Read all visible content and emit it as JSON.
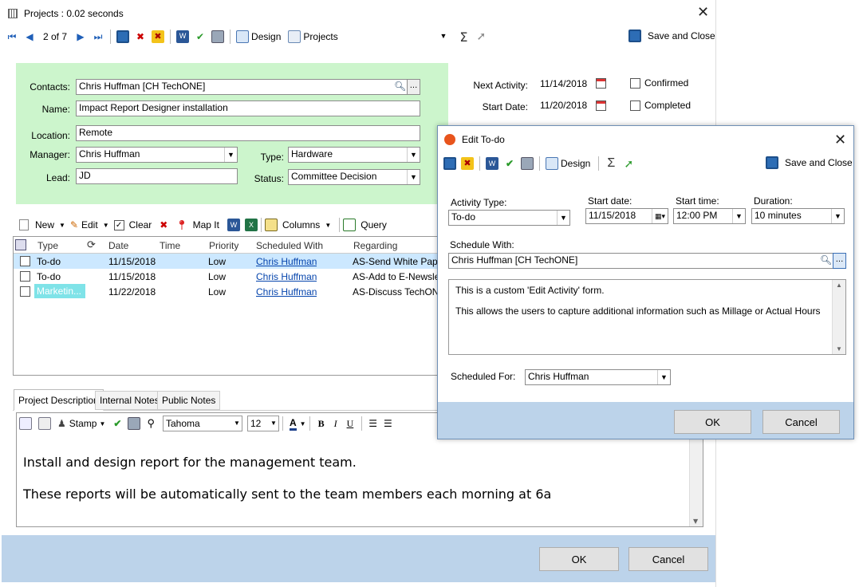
{
  "main": {
    "title": "Projects : 0.02 seconds",
    "nav": {
      "position": "2 of 7"
    },
    "toolbar": {
      "design": "Design",
      "view": "Projects",
      "save_close": "Save and Close"
    },
    "form": {
      "contacts_label": "Contacts:",
      "contacts_value": "Chris Huffman [CH TechONE]",
      "name_label": "Name:",
      "name_value": "Impact Report Designer installation",
      "location_label": "Location:",
      "location_value": "Remote",
      "manager_label": "Manager:",
      "manager_value": "Chris Huffman",
      "type_label": "Type:",
      "type_value": "Hardware",
      "lead_label": "Lead:",
      "lead_value": "JD",
      "status_label": "Status:",
      "status_value": "Committee Decision",
      "next_activity_label": "Next Activity:",
      "next_activity_value": "11/14/2018",
      "start_date_label": "Start Date:",
      "start_date_value": "11/20/2018",
      "confirmed_label": "Confirmed",
      "completed_label": "Completed"
    },
    "grid_toolbar": {
      "new": "New",
      "edit": "Edit",
      "clear": "Clear",
      "map": "Map It",
      "columns": "Columns",
      "query": "Query"
    },
    "grid": {
      "columns": [
        "Type",
        "Date",
        "Time",
        "Priority",
        "Scheduled With",
        "Regarding"
      ],
      "rows": [
        {
          "type": "To-do",
          "date": "11/15/2018",
          "time": "",
          "priority": "Low",
          "with": "Chris Huffman",
          "regarding": "AS-Send White Paper"
        },
        {
          "type": "To-do",
          "date": "11/15/2018",
          "time": "",
          "priority": "Low",
          "with": "Chris Huffman",
          "regarding": "AS-Add to E-Newslet"
        },
        {
          "type": "Marketin...",
          "date": "11/22/2018",
          "time": "",
          "priority": "Low",
          "with": "Chris Huffman",
          "regarding": "AS-Discuss TechONE"
        }
      ]
    },
    "tabs": [
      "Project Description",
      "Internal Notes",
      "Public Notes"
    ],
    "editor": {
      "stamp": "Stamp",
      "font": "Tahoma",
      "size": "12",
      "line1": "Install and design report for the management team.",
      "line2": "These reports will be automatically sent to the team members each morning at 6a"
    },
    "ok": "OK",
    "cancel": "Cancel"
  },
  "dialog": {
    "title": "Edit To-do",
    "toolbar": {
      "design": "Design",
      "save_close": "Save and Close"
    },
    "activity_type_label": "Activity Type:",
    "activity_type_value": "To-do",
    "start_date_label": "Start date:",
    "start_date_value": "11/15/2018",
    "start_time_label": "Start time:",
    "start_time_value": "12:00 PM",
    "duration_label": "Duration:",
    "duration_value": "10 minutes",
    "schedule_with_label": "Schedule With:",
    "schedule_with_value": "Chris Huffman [CH TechONE]",
    "notes_line1": "This is a custom 'Edit Activity' form.",
    "notes_line2": "This allows the users to capture additional information such as Millage or Actual Hours",
    "scheduled_for_label": "Scheduled For:",
    "scheduled_for_value": "Chris Huffman",
    "ok": "OK",
    "cancel": "Cancel"
  },
  "colors": {
    "form_bg": "#ccf5cc",
    "footer_bg": "#bcd3ea",
    "selected_row": "#cce8ff",
    "marketing_badge": "#7fe3e8"
  }
}
